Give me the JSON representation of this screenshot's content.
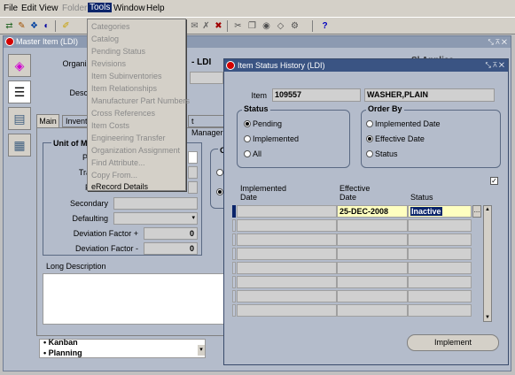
{
  "menubar": {
    "items": [
      "File",
      "Edit",
      "View",
      "Folder",
      "Tools",
      "Window",
      "Help"
    ]
  },
  "master_window": {
    "title": "Master Item (LDI)",
    "organization_label": "Organiz",
    "organization_value": "- LDI",
    "description_label": "Descr",
    "tabs": [
      "Main",
      "Invent",
      "t Manager"
    ],
    "uom_group_label": "Unit of M",
    "fields": {
      "primary_label": "Pr",
      "tracking_label": "Tra",
      "pricing_label": "P",
      "secondary_label": "Secondary",
      "defaulting_label": "Defaulting",
      "dev_plus_label": "Deviation Factor +",
      "dev_plus_value": "0",
      "dev_minus_label": "Deviation Factor -",
      "dev_minus_value": "0",
      "long_desc_label": "Long Description",
      "right_group_label": "C"
    },
    "bottom_list": [
      "Kanban",
      "Planning"
    ],
    "behind_text": "Sl     Applica"
  },
  "tools_menu": {
    "items": [
      {
        "label": "Categories",
        "enabled": false
      },
      {
        "label": "Catalog",
        "enabled": false
      },
      {
        "label": "Pending Status",
        "enabled": false
      },
      {
        "label": "Revisions",
        "enabled": false
      },
      {
        "label": "Item Subinventories",
        "enabled": false
      },
      {
        "label": "Item Relationships",
        "enabled": false
      },
      {
        "label": "Manufacturer Part Numbers",
        "enabled": false
      },
      {
        "label": "Cross References",
        "enabled": false
      },
      {
        "label": "Item Costs",
        "enabled": false
      },
      {
        "label": "Engineering Transfer",
        "enabled": false
      },
      {
        "label": "Organization Assignment",
        "enabled": false
      },
      {
        "label": "Find Attribute...",
        "enabled": false
      },
      {
        "label": "Copy From...",
        "enabled": false
      },
      {
        "label": "eRecord Details",
        "enabled": true
      }
    ]
  },
  "status_history": {
    "title": "Item Status History (LDI)",
    "item_label": "Item",
    "item_number": "109557",
    "item_description": "WASHER,PLAIN",
    "status_group": {
      "label": "Status",
      "options": [
        "Pending",
        "Implemented",
        "All"
      ],
      "selected": "Pending"
    },
    "order_group": {
      "label": "Order By",
      "options": [
        "Implemented Date",
        "Effective Date",
        "Status"
      ],
      "selected": "Effective Date"
    },
    "columns": {
      "implemented_date": [
        "Implemented",
        "Date"
      ],
      "effective_date": [
        "Effective",
        "Date"
      ],
      "status": [
        "",
        "Status"
      ]
    },
    "rows": [
      {
        "implemented_date": "",
        "effective_date": "25-DEC-2008",
        "status": "Inactive"
      }
    ],
    "implement_button": "Implement",
    "lov_button": "..."
  },
  "colors": {
    "highlight": "#0a246a",
    "active_title": "#3a5483",
    "inactive_title": "#8c9ab1",
    "required_field": "#ffffc0"
  }
}
